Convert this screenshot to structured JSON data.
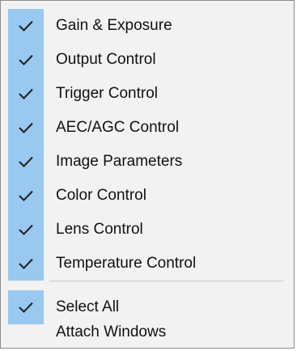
{
  "menu": {
    "items": [
      {
        "label": "Gain & Exposure",
        "checked": true
      },
      {
        "label": "Output Control",
        "checked": true
      },
      {
        "label": "Trigger Control",
        "checked": true
      },
      {
        "label": "AEC/AGC Control",
        "checked": true
      },
      {
        "label": "Image Parameters",
        "checked": true
      },
      {
        "label": "Color Control",
        "checked": true
      },
      {
        "label": "Lens Control",
        "checked": true
      },
      {
        "label": "Temperature Control",
        "checked": true
      }
    ],
    "select_all": {
      "label": "Select All",
      "checked": true
    },
    "attach_windows": {
      "label": "Attach Windows",
      "checked": false
    }
  },
  "colors": {
    "check_highlight": "#99c8f0",
    "check_mark": "#1f1f1f",
    "menu_background": "#f2f2f2"
  },
  "icons": {
    "check": "check-icon"
  }
}
